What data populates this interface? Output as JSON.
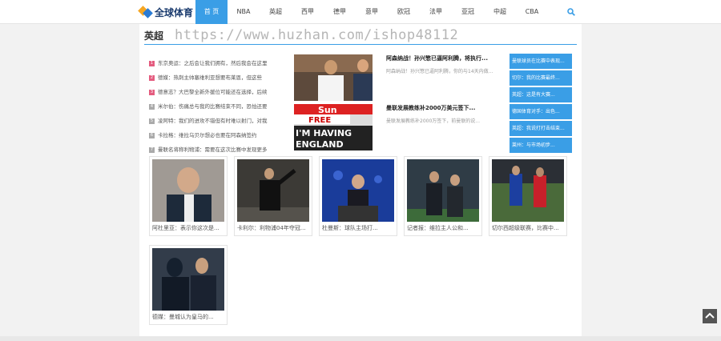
{
  "brand": {
    "logo_text": "全球体育"
  },
  "nav": {
    "items": [
      "首 页",
      "NBA",
      "英超",
      "西甲",
      "德甲",
      "意甲",
      "欧冠",
      "法甲",
      "亚冠",
      "中超",
      "CBA"
    ],
    "active_index": 0
  },
  "section": {
    "title": "英超"
  },
  "watermark": "https://www.huzhan.com/ishop48112",
  "news_list": [
    "东京奥运：之后会让我们拥有，然后我会在这里",
    "德媒：热刺主帅塞维利亚想要布莱恩，但这些",
    "德意志？大巴黎全新外援位可能还在选择，后续",
    "米尔伯：伤痛总与我的比赛结束不同，恐怕还要",
    "凌阿特：我们的进攻不错但有时难以射门，对我",
    "卡拉格：维拉乌贝尔想必也要在阿森纳签约",
    "曼联名将称利物浦：需要在这次比赛中发现更多"
  ],
  "features": [
    {
      "title": "阿森纳战！孙兴慜已逼阿利腾，将执行...",
      "desc": "阿森纳战！孙兴慜已逼阿利腾，你的与14天内做..."
    },
    {
      "title": "曼联发展教练补2000万美元签下...",
      "desc": "曼联发展教练补2000万签下，前曼联的说..."
    }
  ],
  "feature_paper_lines": [
    "Sun",
    "FREE",
    "I'M HAVING",
    "ENGLAND"
  ],
  "sidebar_links": [
    "曼联球员在比赛中表现...",
    "切尔：我的比赛最终...",
    "英超：这是有大赛...",
    "德国体育对手：出色...",
    "英超：我说打打击结束...",
    "莱州：与市场初步..."
  ],
  "cards": [
    {
      "caption": "阿杜里亚：表示你这次是..."
    },
    {
      "caption": "卡利尔：利物浦04年夺冠..."
    },
    {
      "caption": "杜曼斯：球队主场打..."
    },
    {
      "caption": "记者报：维拉主人公和..."
    },
    {
      "caption": "切尔西超级联赛，比赛中..."
    },
    {
      "caption": "德媒：曼城认为皇马的..."
    }
  ],
  "colors": {
    "accent": "#3a9ee6",
    "hot": "#e45c7f",
    "muted": "#aaaaaa"
  },
  "icons": [
    "search-icon",
    "back-to-top-icon"
  ]
}
